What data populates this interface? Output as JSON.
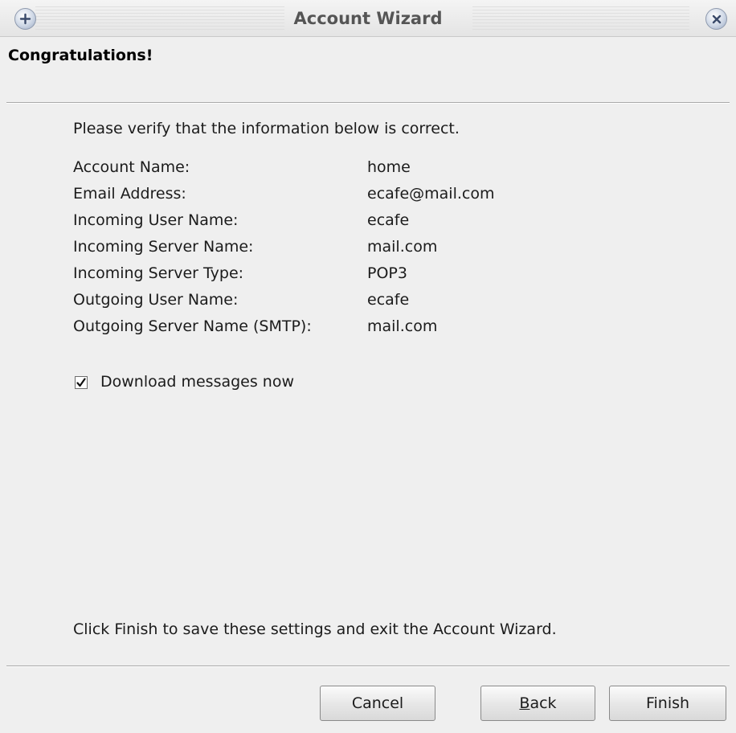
{
  "window": {
    "title": "Account Wizard"
  },
  "header": {
    "page_title": "Congratulations!"
  },
  "main": {
    "intro": "Please verify that the information below is correct.",
    "info": [
      {
        "label": "Account Name:",
        "value": "home"
      },
      {
        "label": "Email Address:",
        "value": "ecafe@mail.com"
      },
      {
        "label": "Incoming User Name:",
        "value": "ecafe"
      },
      {
        "label": "Incoming Server Name:",
        "value": "mail.com"
      },
      {
        "label": "Incoming Server Type:",
        "value": "POP3"
      },
      {
        "label": "Outgoing User Name:",
        "value": "ecafe"
      },
      {
        "label": "Outgoing Server Name (SMTP):",
        "value": "mail.com"
      }
    ],
    "download_checkbox": {
      "label": "Download messages now",
      "checked": true
    },
    "outro": "Click Finish to save these settings and exit the Account Wizard."
  },
  "buttons": {
    "cancel": "Cancel",
    "back_mnemonic": "B",
    "back_rest": "ack",
    "finish": "Finish"
  },
  "icons": {
    "titlebar_left": "add-icon",
    "titlebar_right": "close-icon",
    "checkbox_mark": "checkmark-icon"
  },
  "colors": {
    "background": "#efefef",
    "title_text": "#555555",
    "title_button": "#cfd8e6"
  }
}
